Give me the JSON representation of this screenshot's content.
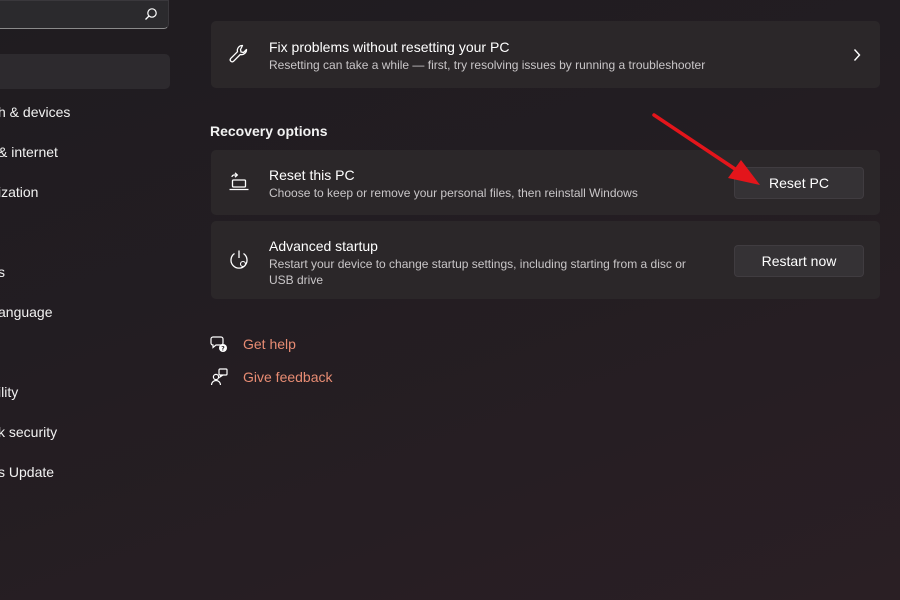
{
  "sidebar": {
    "search_icon": "search-icon",
    "items": [
      {
        "label": "h & devices"
      },
      {
        "label": "& internet"
      },
      {
        "label": "ization"
      },
      {
        "label": "s"
      },
      {
        "label": "anguage"
      },
      {
        "label": "ility"
      },
      {
        "label": "k security"
      },
      {
        "label": "s Update"
      }
    ]
  },
  "fix_card": {
    "icon": "wrench-icon",
    "title": "Fix problems without resetting your PC",
    "subtitle": "Resetting can take a while — first, try resolving issues by running a troubleshooter",
    "chevron_icon": "chevron-right-icon"
  },
  "recovery": {
    "section_title": "Recovery options",
    "reset_card": {
      "icon": "reset-pc-icon",
      "title": "Reset this PC",
      "subtitle": "Choose to keep or remove your personal files, then reinstall Windows",
      "button": "Reset PC"
    },
    "advanced_card": {
      "icon": "advanced-startup-icon",
      "title": "Advanced startup",
      "subtitle_line1": "Restart your device to change startup settings, including starting from a disc or",
      "subtitle_line2": "USB drive",
      "button": "Restart now"
    }
  },
  "links": {
    "help": {
      "icon": "help-icon",
      "label": "Get help"
    },
    "feedback": {
      "icon": "feedback-icon",
      "label": "Give feedback"
    }
  },
  "colors": {
    "accent_link": "#e88c73",
    "arrow": "#e3151b"
  }
}
